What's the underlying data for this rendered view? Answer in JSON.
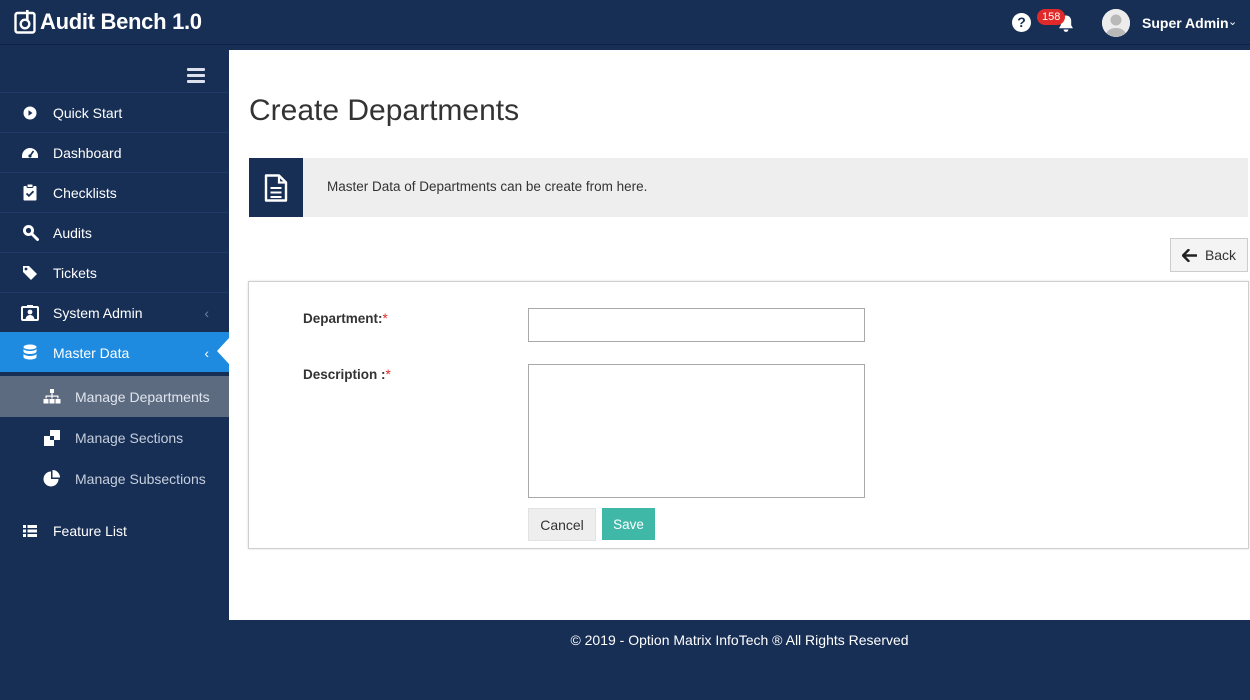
{
  "app": {
    "title": "Audit Bench 1.0",
    "help_label": "?",
    "notification_count": "158",
    "user_name": "Super Admin",
    "colors": {
      "primary_dark": "#172e55",
      "active_blue": "#1e8be0",
      "save_green": "#3fb8a8",
      "badge_red": "#e02a2a"
    }
  },
  "sidebar": {
    "items": [
      {
        "label": "Quick Start",
        "icon": "play-circle-icon"
      },
      {
        "label": "Dashboard",
        "icon": "dashboard-icon"
      },
      {
        "label": "Checklists",
        "icon": "clipboard-check-icon"
      },
      {
        "label": "Audits",
        "icon": "search-icon"
      },
      {
        "label": "Tickets",
        "icon": "ticket-icon"
      },
      {
        "label": "System Admin",
        "icon": "user-admin-icon"
      },
      {
        "label": "Master Data",
        "icon": "database-icon"
      }
    ],
    "subitems": [
      {
        "label": "Manage Departments",
        "icon": "sitemap-icon"
      },
      {
        "label": "Manage Sections",
        "icon": "sections-icon"
      },
      {
        "label": "Manage Subsections",
        "icon": "pie-chart-icon"
      }
    ],
    "feature_list": {
      "label": "Feature List",
      "icon": "list-icon"
    }
  },
  "main": {
    "title": "Create Departments",
    "info_text": "Master Data of Departments can be create from here.",
    "back_label": "Back",
    "form": {
      "department_label": "Department:",
      "description_label": "Description :",
      "required_mark": "*",
      "department_value": "",
      "description_value": "",
      "cancel_label": "Cancel",
      "save_label": "Save"
    }
  },
  "footer": {
    "text": "© 2019 - Option Matrix InfoTech ® All Rights Reserved"
  }
}
